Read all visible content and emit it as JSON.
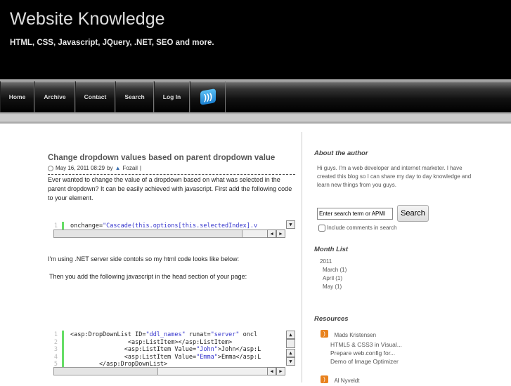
{
  "header": {
    "title": "Website Knowledge",
    "tagline": "HTML, CSS, Javascript, JQuery, .NET, SEO and more."
  },
  "nav": {
    "items": [
      "Home",
      "Archive",
      "Contact",
      "Search",
      "Log In"
    ]
  },
  "post": {
    "title": "Change dropdown values based on parent dropdown value",
    "date": "May 16, 2011 08:29",
    "by": "by",
    "author": "Fozail",
    "sep": "|",
    "intro": "Ever wanted to change the value of  a dropdown based on what was selected in the parent dropdown? It can be easily achieved with javascript. First add the following code to your element.",
    "code1": [
      {
        "n": "1",
        "a": "onchange=",
        "s": "\"Cascade(this.options[this.selectedIndex].v",
        "b": ""
      }
    ],
    "p2": "I'm using .NET server side contols so my html code looks like below:",
    "p3": "Then you add the following javascript in the head section of your page:",
    "code2": [
      {
        "n": "1",
        "a": "<asp:DropDownList ID=",
        "s": "\"ddl_names\"",
        "b": " runat=",
        "s2": "\"server\"",
        "c": " oncl"
      },
      {
        "n": "2",
        "a": "                <asp:ListItem></asp:ListItem>"
      },
      {
        "n": "3",
        "a": "               <asp:ListItem Value=",
        "s": "\"John\"",
        "b": ">John</asp:L"
      },
      {
        "n": "4",
        "a": "               <asp:ListItem Value=",
        "s": "\"Emma\"",
        "b": ">Emma</asp:L"
      },
      {
        "n": "5",
        "a": "        </asp:DropDownList>"
      }
    ]
  },
  "sidebar": {
    "about_title": "About the author",
    "about_text": "Hi guys. I'm a web developer and internet marketer. I have created this blog so I can share my day to day knowledge and learn new things from you guys.",
    "search_placeholder": "Enter search term or APML url",
    "search_value": "Enter search term or APMI",
    "search_button": "Search",
    "include_comments": "Include comments in search",
    "month_title": "Month List",
    "year": "2011",
    "months": [
      "March (1)",
      "April (1)",
      "May (1)"
    ],
    "resources_title": "Resources",
    "feeds": [
      {
        "name": "Mads Kristensen",
        "posts": [
          "HTML5 & CSS3 in Visual...",
          "Prepare web.config for...",
          "Demo of Image Optimizer"
        ]
      },
      {
        "name": "Al Nyveldt",
        "posts": []
      }
    ]
  }
}
